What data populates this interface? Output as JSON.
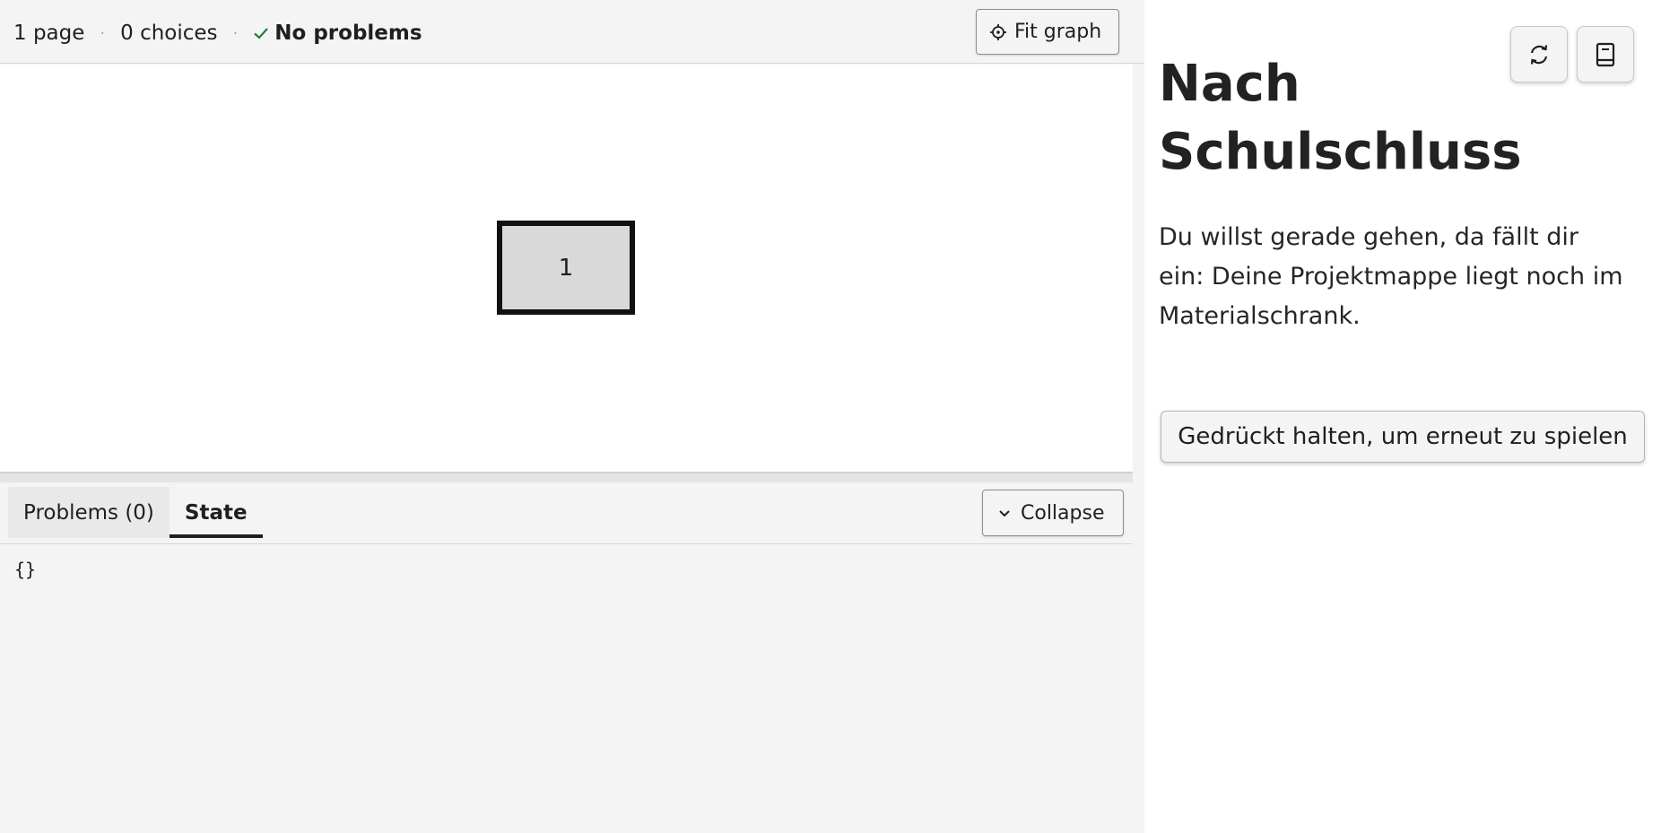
{
  "stats": {
    "pages": "1 page",
    "separator": "·",
    "choices": "0 choices",
    "status": "No problems"
  },
  "toolbar": {
    "fit_graph_label": "Fit graph"
  },
  "graph": {
    "nodes": [
      {
        "label": "1"
      }
    ]
  },
  "bottom_panel": {
    "tabs": [
      {
        "label": "Problems (0)",
        "active": false
      },
      {
        "label": "State",
        "active": true
      }
    ],
    "collapse_label": "Collapse",
    "state_json": "{}"
  },
  "preview": {
    "title": "Nach Schulschluss",
    "body": "Du willst gerade gehen, da fällt dir ein: Deine Projektmappe liegt noch im Materialschrank.",
    "replay_label": "Gedrückt halten, um erneut zu spielen",
    "icons": [
      "reload-icon",
      "book-icon"
    ]
  },
  "colors": {
    "ok_check": "#198038",
    "node_fill": "#d9d9d9",
    "node_border": "#111111"
  }
}
